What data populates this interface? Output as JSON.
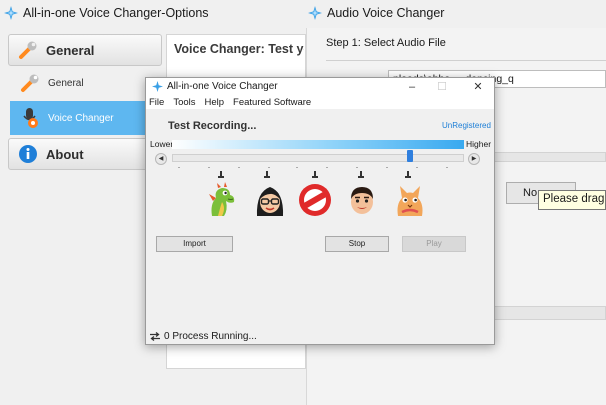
{
  "options_window": {
    "title": "All-in-one Voice Changer-Options",
    "nav": {
      "general_header": "General",
      "items": [
        {
          "label": "General",
          "icon": "wrench-icon"
        },
        {
          "label": "Voice Changer",
          "icon": "microphone-settings-icon"
        }
      ],
      "about_header": "About"
    },
    "panel_title": "Voice Changer: Test you"
  },
  "audio_window": {
    "title": "Audio Voice Changer",
    "step1": "Step 1: Select Audio File",
    "file_path": "nloads\\abba_-_dancing_q",
    "no_button": "No",
    "tooltip": "Please drag t"
  },
  "dialog": {
    "title": "All-in-one Voice Changer",
    "menu": [
      "File",
      "Tools",
      "Help",
      "Featured Software"
    ],
    "test_recording": "Test Recording...",
    "registration": "UnRegistered",
    "pitch": {
      "lower_label": "Lower",
      "higher_label": "Higher",
      "level": 0.82
    },
    "presets": [
      {
        "name": "dragon-icon"
      },
      {
        "name": "woman-glasses-icon"
      },
      {
        "name": "no-entry-icon"
      },
      {
        "name": "man-icon"
      },
      {
        "name": "cat-icon"
      }
    ],
    "import_button": "Import",
    "stop_button": "Stop",
    "play_button": "Play",
    "status": "0 Process Running...",
    "window_controls": [
      "–",
      "☐",
      "✕"
    ]
  },
  "colors": {
    "accent": "#5eb7f0",
    "slider_thumb": "#2f7fde",
    "link": "#1c7ed6",
    "no_entry_red": "#e02a2a"
  }
}
